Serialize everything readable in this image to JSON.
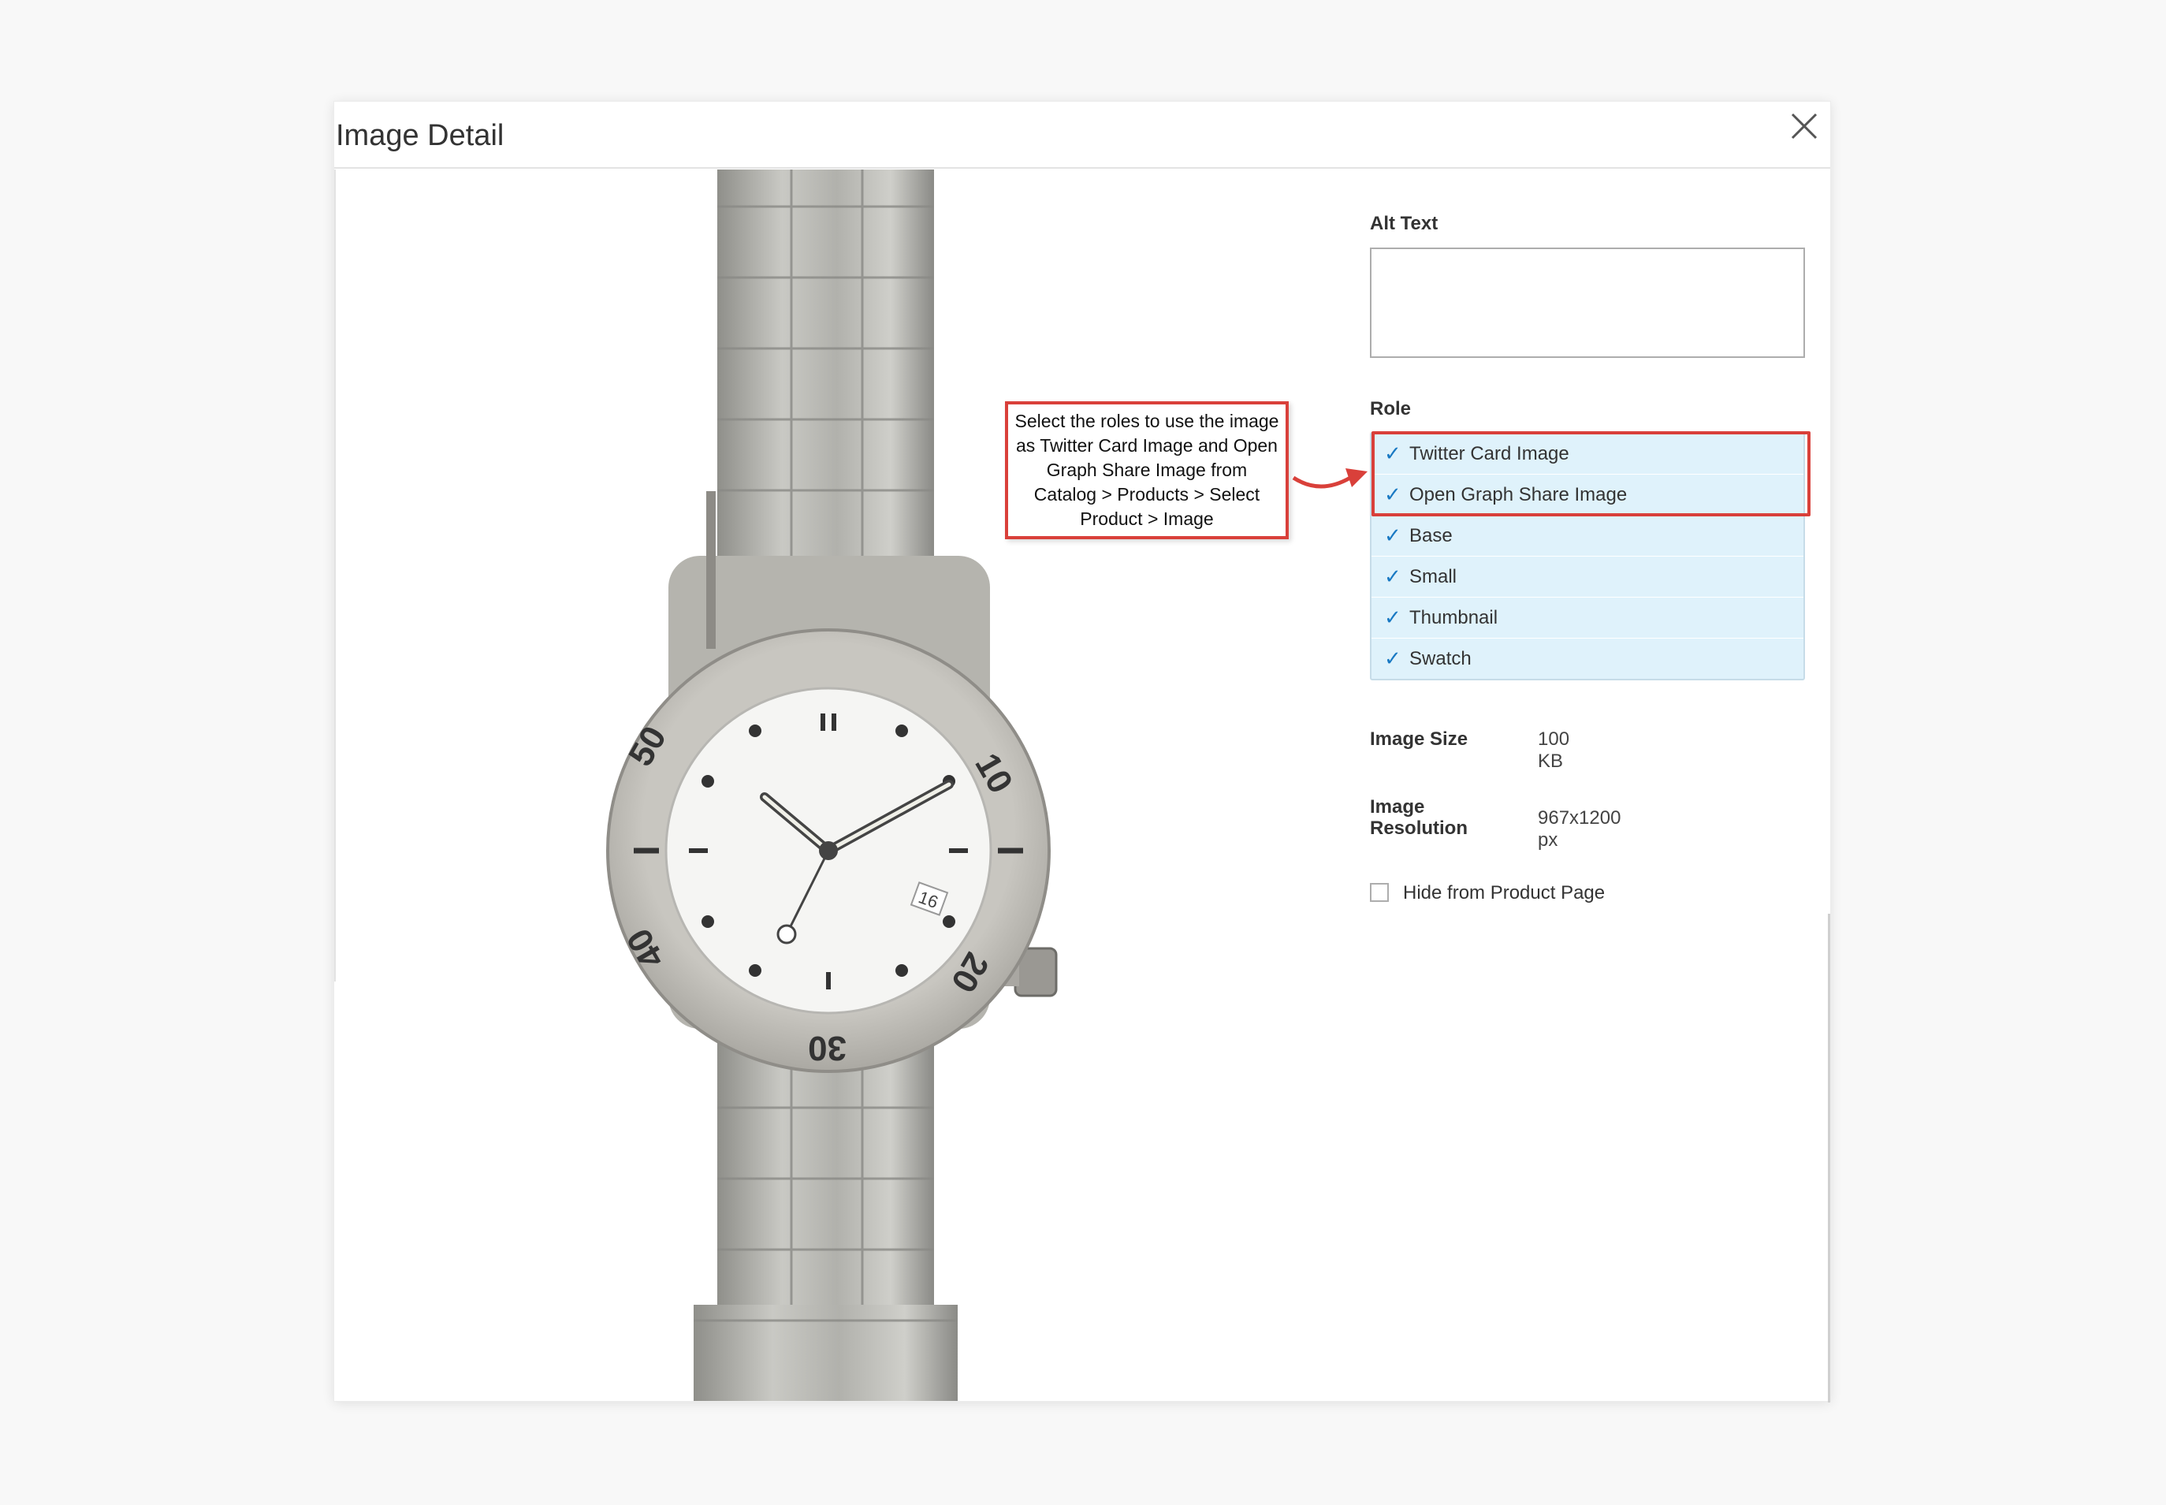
{
  "modal": {
    "title": "Image Detail",
    "close_icon": "close-icon"
  },
  "image": {
    "subject": "wristwatch",
    "bezel_numbers": [
      "10",
      "20",
      "30",
      "40",
      "50"
    ],
    "date": "16"
  },
  "form": {
    "alt_text_label": "Alt Text",
    "alt_text_value": "",
    "role_label": "Role",
    "roles": [
      {
        "label": "Twitter Card Image",
        "checked": true
      },
      {
        "label": "Open Graph Share Image",
        "checked": true
      },
      {
        "label": "Base",
        "checked": true
      },
      {
        "label": "Small",
        "checked": true
      },
      {
        "label": "Thumbnail",
        "checked": true
      },
      {
        "label": "Swatch",
        "checked": true
      }
    ],
    "image_size_label": "Image Size",
    "image_size_value": "100 KB",
    "image_resolution_label": "Image Resolution",
    "image_resolution_value": "967x1200 px",
    "hide_label": "Hide from Product Page",
    "hide_checked": false
  },
  "callout": {
    "text": "Select the roles to use the image as Twitter Card Image and Open Graph Share Image from Catalog > Products > Select Product > Image"
  },
  "colors": {
    "highlight": "#d9403a",
    "role_bg": "#dff2fb",
    "check": "#1979c3"
  }
}
